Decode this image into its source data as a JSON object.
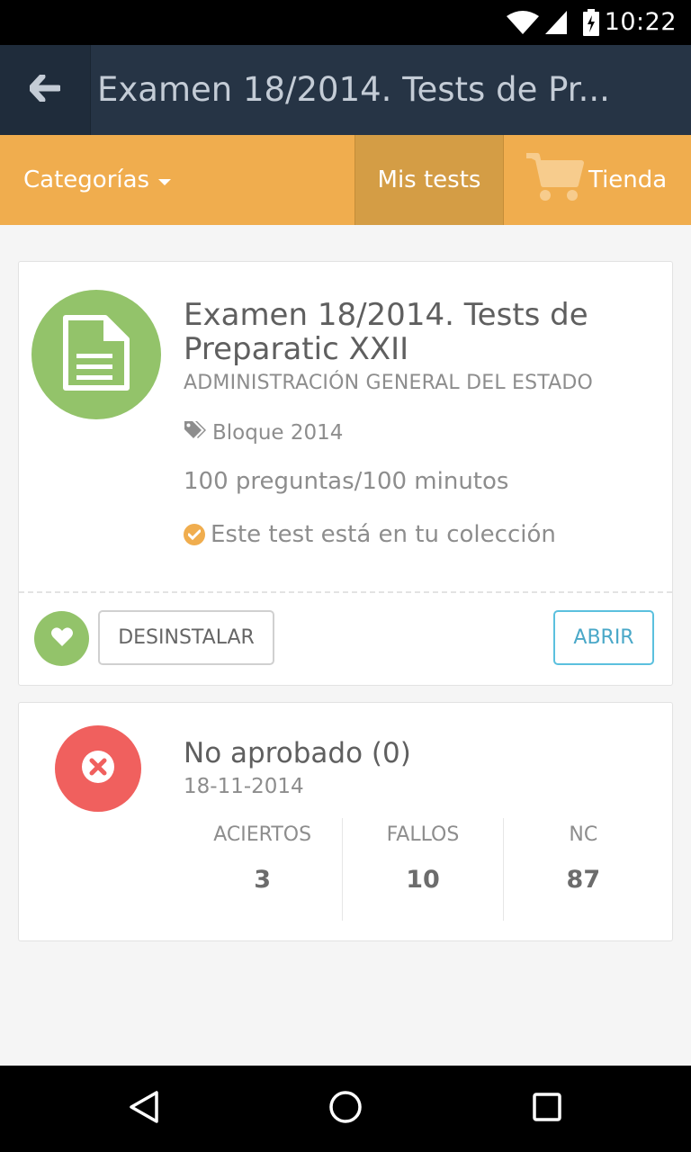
{
  "status_bar": {
    "time": "10:22"
  },
  "appbar": {
    "title": "Examen 18/2014. Tests de Pr..."
  },
  "nav": {
    "categorias_label": "Categorías",
    "mis_tests_label": "Mis tests",
    "tienda_label": "Tienda"
  },
  "test": {
    "title": "Examen 18/2014. Tests de Preparatic XXII",
    "category": "ADMINISTRACIÓN GENERAL DEL ESTADO",
    "tag": "Bloque 2014",
    "meta": "100 preguntas/100 minutos",
    "owned_text": "Este test está en tu colección",
    "uninstall_label": "DESINSTALAR",
    "open_label": "ABRIR"
  },
  "result": {
    "title": "No aprobado (0)",
    "date": "18-11-2014",
    "stats": [
      {
        "label": "ACIERTOS",
        "value": "3"
      },
      {
        "label": "FALLOS",
        "value": "10"
      },
      {
        "label": "NC",
        "value": "87"
      }
    ]
  },
  "colors": {
    "appbar": "#263445",
    "nav": "#f0ad4e",
    "success": "#93c36a",
    "danger": "#f0605e",
    "info": "#5bc0de"
  },
  "icons": {
    "back": "arrow-left-icon",
    "cart": "shopping-cart-icon",
    "document": "document-icon",
    "tag": "tags-icon",
    "check": "check-circle-icon",
    "heart": "heart-icon",
    "fail": "times-circle-icon"
  }
}
